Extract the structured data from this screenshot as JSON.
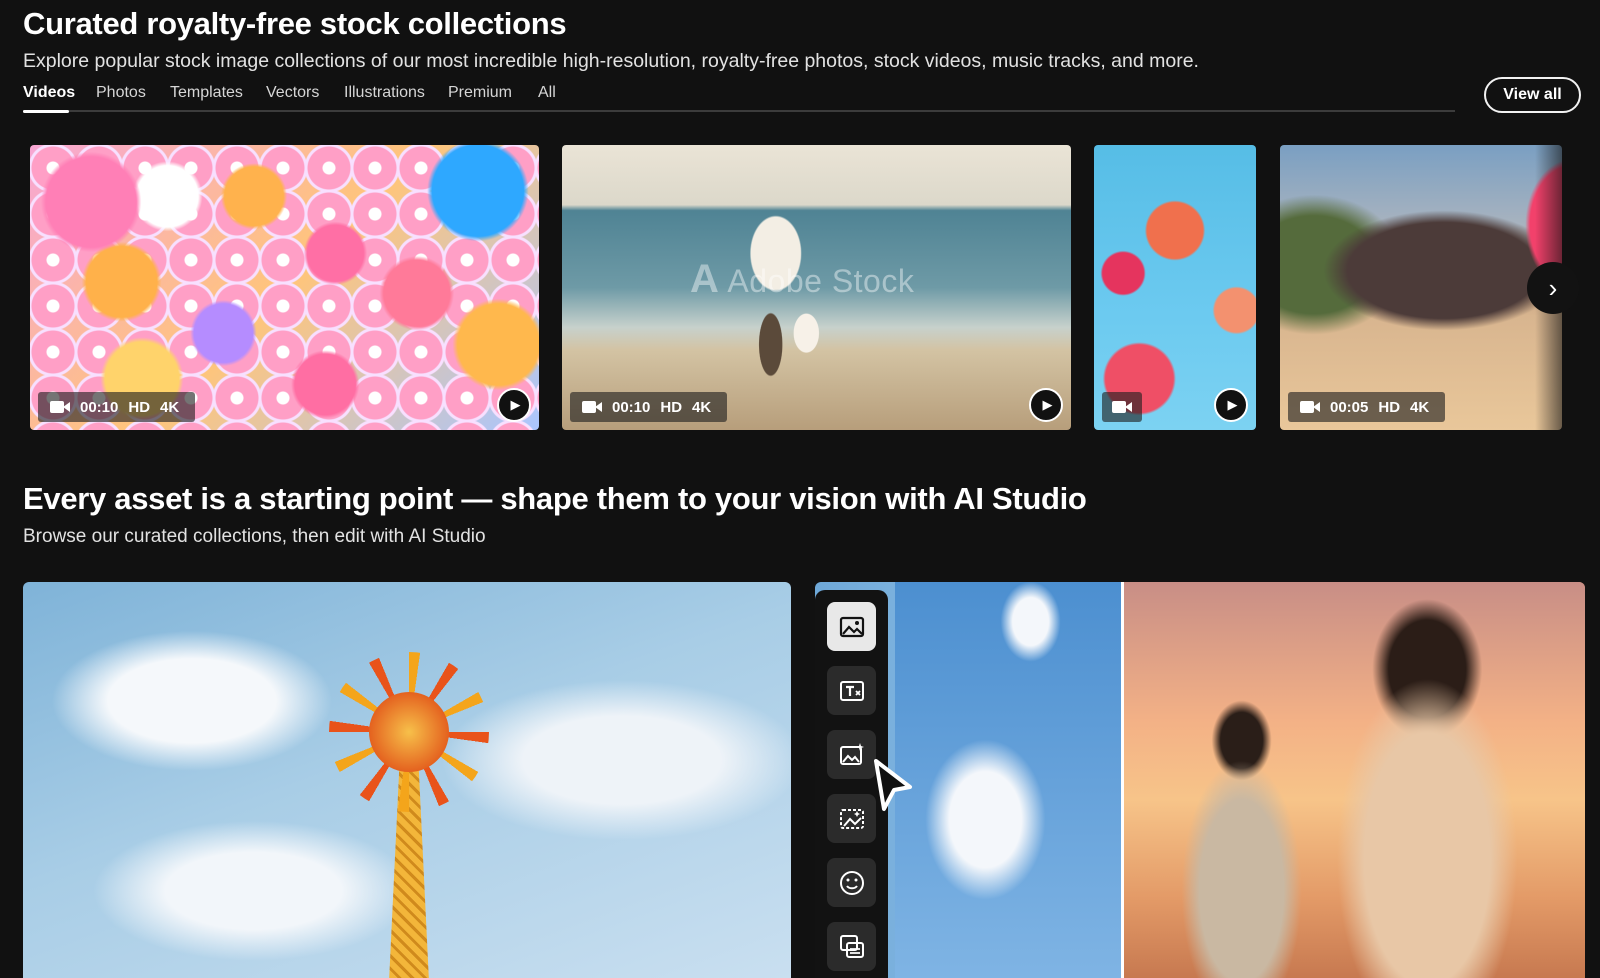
{
  "section1": {
    "title": "Curated royalty-free stock collections",
    "subtitle": "Explore popular stock image collections of our most incredible high-resolution, royalty-free photos, stock videos, music tracks, and more.",
    "tabs": [
      "Videos",
      "Photos",
      "Templates",
      "Vectors",
      "Illustrations",
      "Premium",
      "All"
    ],
    "active_tab": "Videos",
    "view_all": "View all"
  },
  "cards": [
    {
      "duration": "00:10",
      "quality": "HD",
      "resolution": "4K",
      "thumbnail": "colorful-bubbles"
    },
    {
      "duration": "00:10",
      "quality": "HD",
      "resolution": "4K",
      "thumbnail": "family-on-beach",
      "watermark": "Adobe Stock"
    },
    {
      "duration": "",
      "quality": "",
      "resolution": "",
      "thumbnail": "poppies-sky"
    },
    {
      "duration": "00:05",
      "quality": "HD",
      "resolution": "4K",
      "thumbnail": "desert-balloon"
    }
  ],
  "section2": {
    "title": "Every asset is a starting point — shape them to your vision with AI Studio",
    "subtitle": "Browse our curated collections, then edit with AI Studio"
  },
  "toolbar_icons": [
    "image-icon",
    "text-effects-icon",
    "generate-image-icon",
    "generative-fill-icon",
    "face-icon",
    "layers-icon"
  ],
  "colors": {
    "background": "#111111",
    "text": "#ffffff",
    "toolbar": "#121212"
  }
}
